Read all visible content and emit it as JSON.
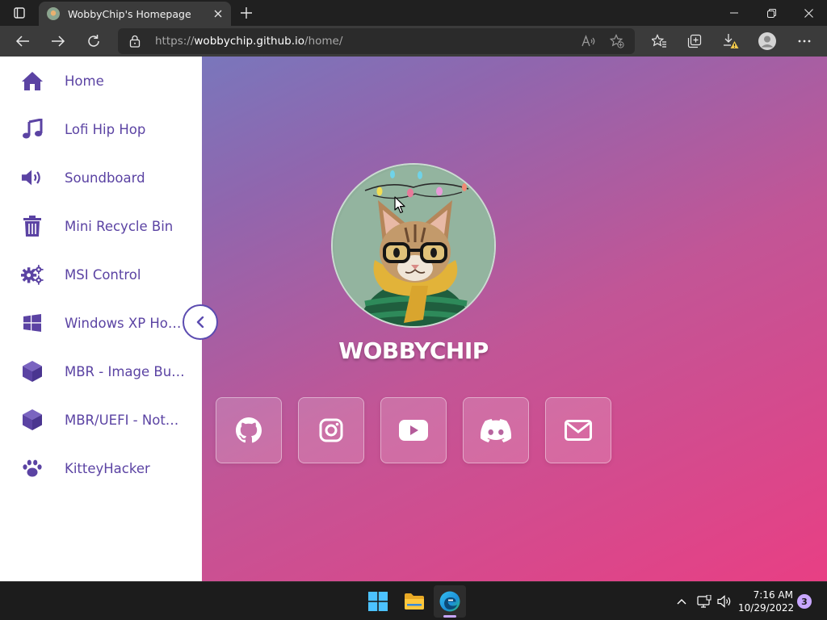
{
  "browser": {
    "tab_title": "WobbyChip's Homepage",
    "url_scheme": "https://",
    "url_host": "wobbychip.github.io",
    "url_path": "/home/"
  },
  "sidebar": {
    "items": [
      {
        "label": "Home",
        "icon": "home-icon"
      },
      {
        "label": "Lofi Hip Hop",
        "icon": "music-note-icon"
      },
      {
        "label": "Soundboard",
        "icon": "speaker-icon"
      },
      {
        "label": "Mini Recycle Bin",
        "icon": "trash-icon"
      },
      {
        "label": "MSI Control",
        "icon": "gears-icon"
      },
      {
        "label": "Windows XP Horror Edition",
        "icon": "windows-icon"
      },
      {
        "label": "MBR - Image Builder",
        "icon": "cube-icon"
      },
      {
        "label": "MBR/UEFI - Note Builder",
        "icon": "cube-icon"
      },
      {
        "label": "KitteyHacker",
        "icon": "paw-icon"
      }
    ],
    "accent_color": "#5b43a3"
  },
  "profile": {
    "name": "WOBBYCHIP"
  },
  "social_links": [
    {
      "icon": "github-icon"
    },
    {
      "icon": "instagram-icon"
    },
    {
      "icon": "youtube-icon"
    },
    {
      "icon": "discord-icon"
    },
    {
      "icon": "email-icon"
    }
  ],
  "taskbar": {
    "time": "7:16 AM",
    "date": "10/29/2022",
    "notification_count": "3"
  }
}
